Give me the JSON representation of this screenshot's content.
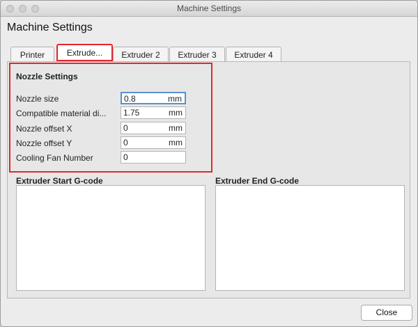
{
  "window": {
    "title": "Machine Settings"
  },
  "heading": "Machine Settings",
  "tabs": [
    {
      "label": "Printer",
      "active": false
    },
    {
      "label": "Extrude...",
      "active": true
    },
    {
      "label": "Extruder 2",
      "active": false
    },
    {
      "label": "Extruder 3",
      "active": false
    },
    {
      "label": "Extruder 4",
      "active": false
    }
  ],
  "nozzle_settings": {
    "title": "Nozzle Settings",
    "rows": [
      {
        "label": "Nozzle size",
        "value": "0.8",
        "unit": "mm"
      },
      {
        "label": "Compatible material di...",
        "value": "1.75",
        "unit": "mm"
      },
      {
        "label": "Nozzle offset X",
        "value": "0",
        "unit": "mm"
      },
      {
        "label": "Nozzle offset Y",
        "value": "0",
        "unit": "mm"
      },
      {
        "label": "Cooling Fan Number",
        "value": "0",
        "unit": ""
      }
    ]
  },
  "gcode": {
    "start_label": "Extruder Start G-code",
    "start_value": "",
    "end_label": "Extruder End G-code",
    "end_value": ""
  },
  "close_button": "Close",
  "colors": {
    "highlight": "#e0282d",
    "focus": "#5a8fd6"
  }
}
